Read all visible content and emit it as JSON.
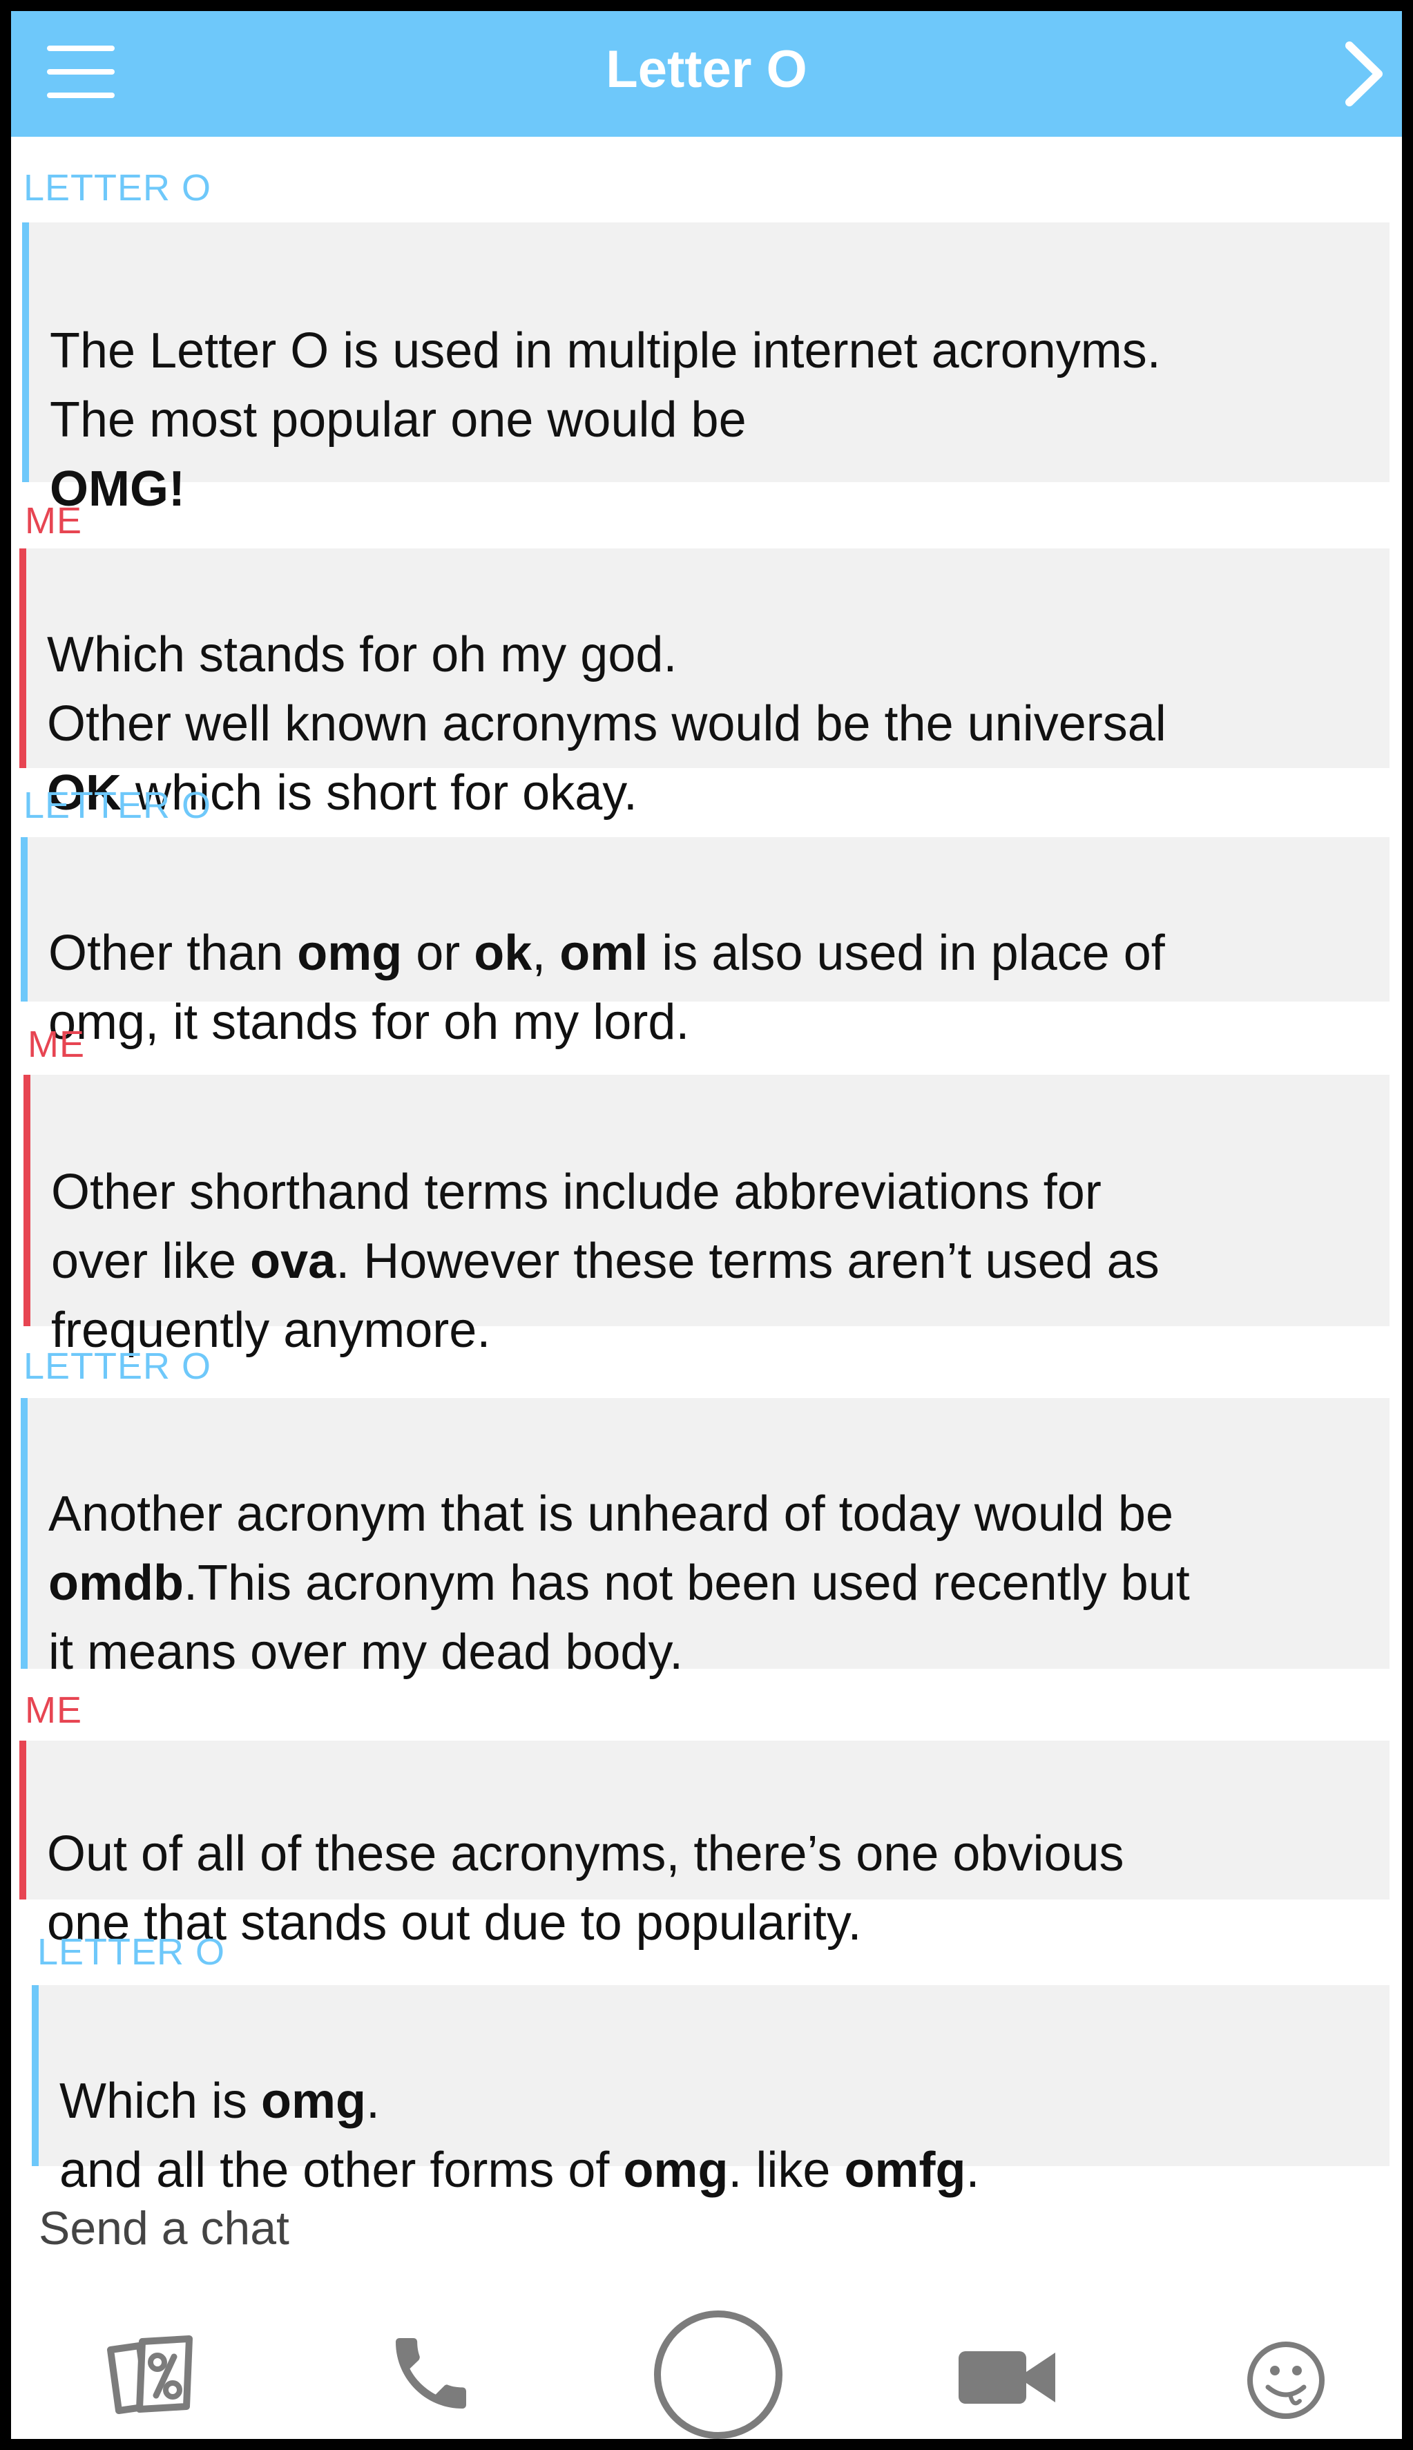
{
  "header": {
    "title": "Letter O",
    "menu_icon": "hamburger-menu-icon",
    "next_icon": "chevron-right-icon",
    "background": "#6ec8fa"
  },
  "colors": {
    "other": "#6ec8fa",
    "me": "#e74552",
    "bubble": "#f1f1f1"
  },
  "messages": [
    {
      "sender": "LETTER O",
      "text": [
        {
          "t": "The Letter O is used in multiple internet acronyms.\nThe most popular one would be\n"
        },
        {
          "t": "OMG!",
          "b": true
        }
      ]
    },
    {
      "sender": "ME",
      "text": [
        {
          "t": "Which stands for oh my god.\nOther well known acronyms would be the universal\n"
        },
        {
          "t": "OK",
          "b": true
        },
        {
          "t": " which is short for okay."
        }
      ]
    },
    {
      "sender": "LETTER O",
      "text": [
        {
          "t": "Other than "
        },
        {
          "t": "omg",
          "b": true
        },
        {
          "t": " or "
        },
        {
          "t": "ok",
          "b": true
        },
        {
          "t": ", "
        },
        {
          "t": "oml",
          "b": true
        },
        {
          "t": " is also used in place of\nomg, it stands for oh my lord."
        }
      ]
    },
    {
      "sender": "ME",
      "text": [
        {
          "t": "Other shorthand terms include abbreviations for\nover like "
        },
        {
          "t": "ova",
          "b": true
        },
        {
          "t": ". However these terms aren’t used as\nfrequently anymore."
        }
      ]
    },
    {
      "sender": "LETTER O",
      "text": [
        {
          "t": "Another acronym that is unheard of today would be\n"
        },
        {
          "t": "omdb",
          "b": true
        },
        {
          "t": ".This acronym has not been used recently but\nit means over my dead body."
        }
      ]
    },
    {
      "sender": "ME",
      "text": [
        {
          "t": "Out of all of these acronyms, there’s one obvious\none that stands out due to popularity."
        }
      ]
    },
    {
      "sender": "LETTER O",
      "text": [
        {
          "t": "Which is "
        },
        {
          "t": "omg",
          "b": true
        },
        {
          "t": ".\nand all the other forms of "
        },
        {
          "t": "omg",
          "b": true
        },
        {
          "t": ". like "
        },
        {
          "t": "omfg",
          "b": true
        },
        {
          "t": "."
        }
      ]
    }
  ],
  "input": {
    "placeholder": "Send a chat"
  },
  "toolbar": [
    {
      "icon": "memories-cards-icon"
    },
    {
      "icon": "phone-icon"
    },
    {
      "icon": "capture-circle-icon"
    },
    {
      "icon": "video-camera-icon"
    },
    {
      "icon": "emoji-face-icon"
    }
  ]
}
